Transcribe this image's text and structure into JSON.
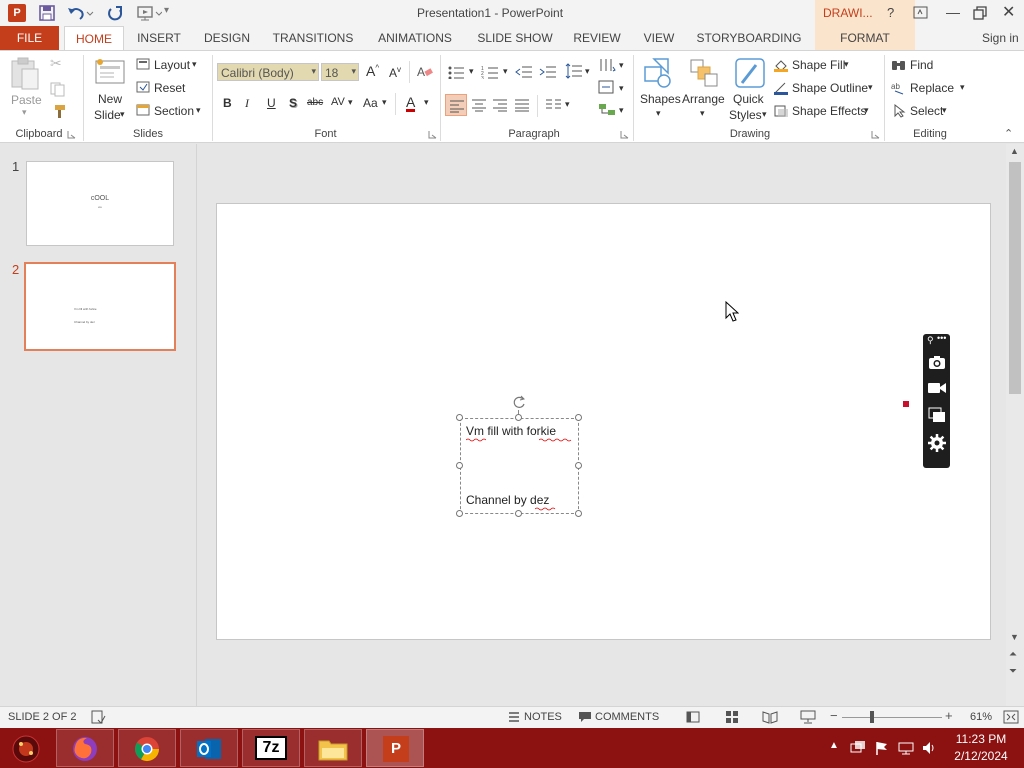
{
  "app": {
    "title": "Presentation1 - PowerPoint",
    "context_tab_group": "DRAWI...",
    "help": "?",
    "sign_in": "Sign in"
  },
  "tabs": [
    "FILE",
    "HOME",
    "INSERT",
    "DESIGN",
    "TRANSITIONS",
    "ANIMATIONS",
    "SLIDE SHOW",
    "REVIEW",
    "VIEW",
    "STORYBOARDING",
    "FORMAT"
  ],
  "ribbon": {
    "clipboard": {
      "label": "Clipboard",
      "paste": "Paste"
    },
    "slides": {
      "label": "Slides",
      "new_slide_1": "New",
      "new_slide_2": "Slide",
      "layout": "Layout",
      "reset": "Reset",
      "section": "Section"
    },
    "font": {
      "label": "Font",
      "family": "Calibri (Body)",
      "size": "18",
      "bold": "B",
      "italic": "I",
      "underline": "U",
      "shadow": "S",
      "strike": "abc",
      "spacing": "AV",
      "case": "Aa",
      "color": "A"
    },
    "paragraph": {
      "label": "Paragraph"
    },
    "drawing": {
      "label": "Drawing",
      "shapes": "Shapes",
      "arrange": "Arrange",
      "quick_styles_1": "Quick",
      "quick_styles_2": "Styles",
      "shape_fill": "Shape Fill",
      "shape_outline": "Shape Outline",
      "shape_effects": "Shape Effects"
    },
    "editing": {
      "label": "Editing",
      "find": "Find",
      "replace": "Replace",
      "select": "Select"
    }
  },
  "thumbnails": [
    {
      "number": "1",
      "title": "cOOL",
      "sub": "ele"
    },
    {
      "number": "2",
      "line1": "Vm fill with forkie",
      "line2": "Channel by dez"
    }
  ],
  "slide": {
    "line1": "Vm fill with forkie",
    "line2": "Channel by dez"
  },
  "status": {
    "slide_indicator": "SLIDE 2 OF 2",
    "notes": "NOTES",
    "comments": "COMMENTS",
    "zoom": "61%"
  },
  "taskbar": {
    "time": "11:23 PM",
    "date": "2/12/2024",
    "apps": [
      "firefox",
      "chrome",
      "outlook",
      "7zip",
      "file-explorer",
      "powerpoint"
    ]
  },
  "colors": {
    "accent": "#c43e1c",
    "taskbar": "#8c1111",
    "context_tab": "#fbe4cc"
  }
}
